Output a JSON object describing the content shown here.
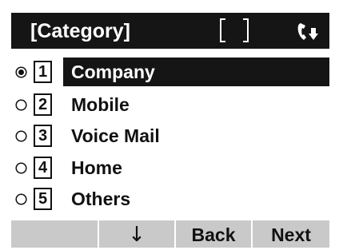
{
  "header": {
    "title": "[Category]",
    "field_value": "",
    "status_icon": "handset-icon"
  },
  "options": [
    {
      "number": "1",
      "label": "Company",
      "selected": true
    },
    {
      "number": "2",
      "label": "Mobile",
      "selected": false
    },
    {
      "number": "3",
      "label": "Voice Mail",
      "selected": false
    },
    {
      "number": "4",
      "label": "Home",
      "selected": false
    },
    {
      "number": "5",
      "label": "Others",
      "selected": false
    }
  ],
  "softkeys": {
    "key1": "",
    "key2": "↓",
    "key3": "Back",
    "key4": "Next"
  },
  "colors": {
    "header_bg": "#151515",
    "selected_bg": "#151515",
    "softkey_bg": "#c9c9c9"
  }
}
